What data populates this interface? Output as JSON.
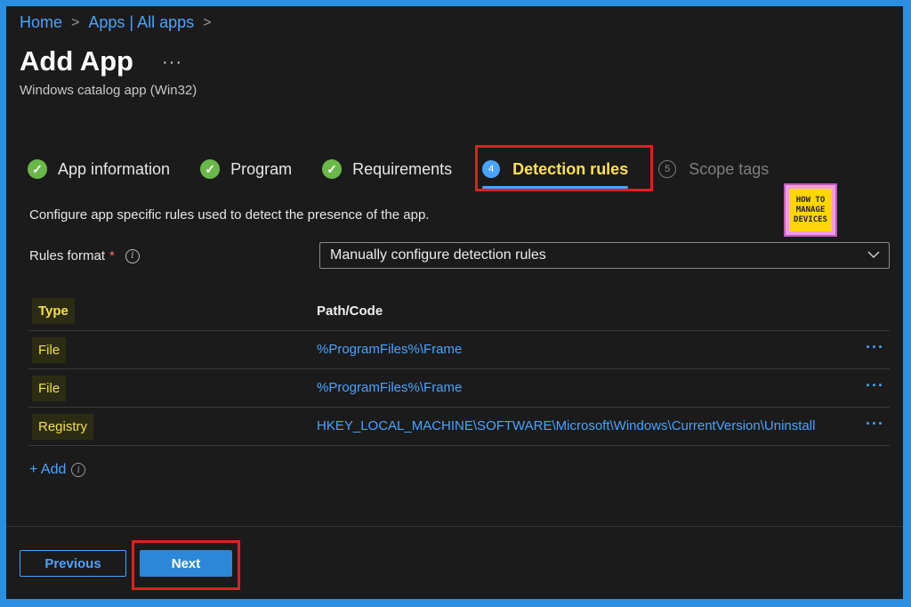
{
  "breadcrumb": [
    "Home",
    "Apps | All apps"
  ],
  "page": {
    "title": "Add App",
    "more": "···",
    "subtitle": "Windows catalog app (Win32)"
  },
  "steps": [
    {
      "label": "App information",
      "status": "complete"
    },
    {
      "label": "Program",
      "status": "complete"
    },
    {
      "label": "Requirements",
      "status": "complete"
    },
    {
      "label": "Detection rules",
      "number": "4",
      "status": "active"
    },
    {
      "label": "Scope tags",
      "number": "5",
      "status": "disabled"
    }
  ],
  "logo": {
    "lines": [
      "HOW TO",
      "MANAGE",
      "DEVICES"
    ]
  },
  "description": "Configure app specific rules used to detect the presence of the app.",
  "rules_format": {
    "label": "Rules format",
    "required_mark": "*",
    "info_icon": "i",
    "value": "Manually configure detection rules"
  },
  "table": {
    "headers": {
      "type": "Type",
      "path": "Path/Code"
    },
    "rows": [
      {
        "type": "File",
        "path": "%ProgramFiles%\\Frame",
        "more": "···"
      },
      {
        "type": "File",
        "path": "%ProgramFiles%\\Frame",
        "more": "···"
      },
      {
        "type": "Registry",
        "path": "HKEY_LOCAL_MACHINE\\SOFTWARE\\Microsoft\\Windows\\CurrentVersion\\Uninstall",
        "more": "···"
      }
    ]
  },
  "add": {
    "label": "+ Add",
    "info_icon": "i"
  },
  "footer": {
    "previous": "Previous",
    "next": "Next"
  },
  "colors": {
    "accent": "#4aa3ff",
    "complete": "#6bb84a",
    "highlight_red": "#e02020",
    "active_text": "#ffe14d"
  }
}
